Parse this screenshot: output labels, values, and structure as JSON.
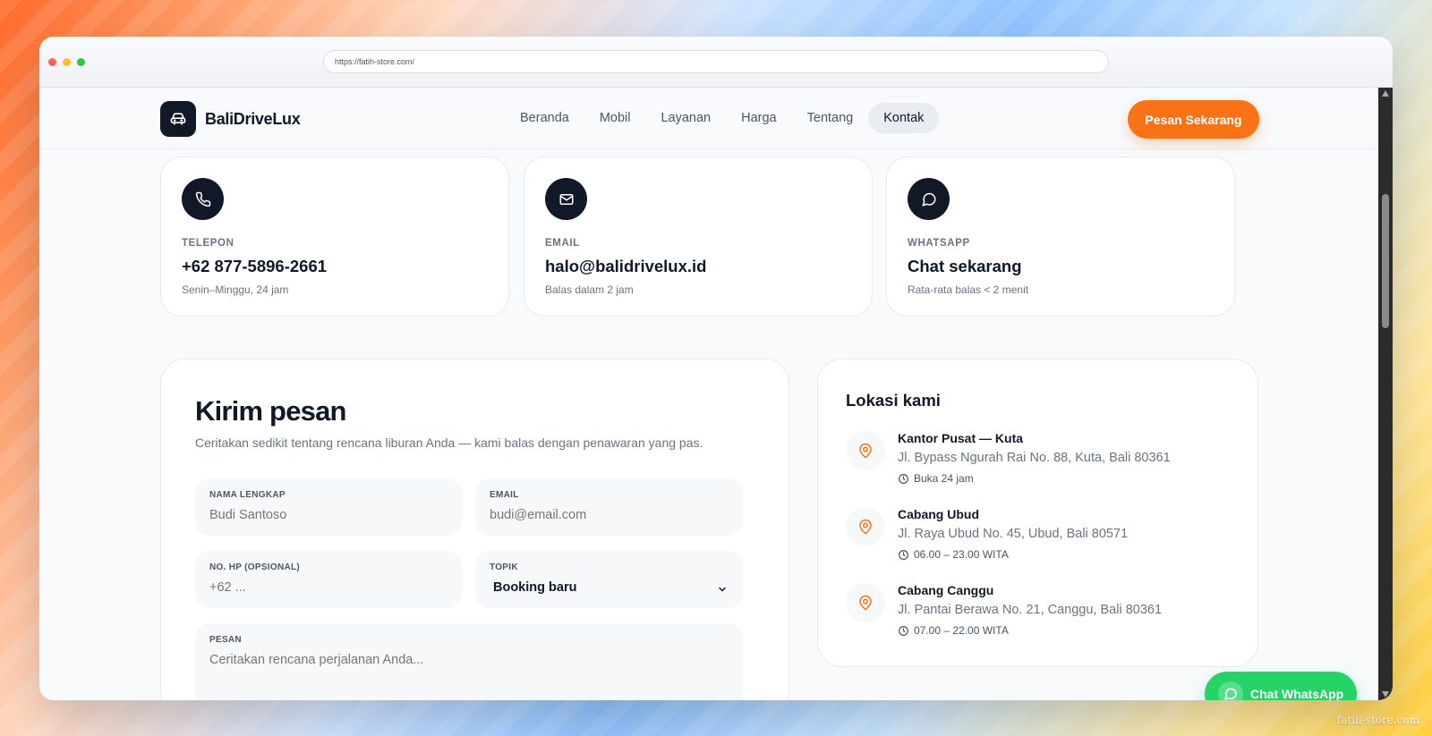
{
  "browser": {
    "url": "https://fatih-store.com/"
  },
  "watermark": "fatih-store.com",
  "header": {
    "brand": "BaliDriveLux",
    "nav": [
      {
        "label": "Beranda"
      },
      {
        "label": "Mobil"
      },
      {
        "label": "Layanan"
      },
      {
        "label": "Harga"
      },
      {
        "label": "Tentang"
      },
      {
        "label": "Kontak",
        "active": true
      }
    ],
    "cta_label": "Pesan Sekarang"
  },
  "contact_cards": [
    {
      "icon": "phone-icon",
      "label": "TELEPON",
      "value": "+62 877-5896-2661",
      "sub": "Senin–Minggu, 24 jam"
    },
    {
      "icon": "mail-icon",
      "label": "EMAIL",
      "value": "halo@balidrivelux.id",
      "sub": "Balas dalam 2 jam"
    },
    {
      "icon": "chat-bubble-icon",
      "label": "WHATSAPP",
      "value": "Chat sekarang",
      "sub": "Rata-rata balas < 2 menit"
    }
  ],
  "form": {
    "title": "Kirim pesan",
    "description": "Ceritakan sedikit tentang rencana liburan Anda — kami balas dengan penawaran yang pas.",
    "fields": {
      "name": {
        "label": "NAMA LENGKAP",
        "placeholder": "Budi Santoso"
      },
      "email": {
        "label": "EMAIL",
        "placeholder": "budi@email.com"
      },
      "phone": {
        "label": "NO. HP (OPSIONAL)",
        "placeholder": "+62 ..."
      },
      "topic": {
        "label": "TOPIK",
        "value": "Booking baru"
      },
      "message": {
        "label": "PESAN",
        "placeholder": "Ceritakan rencana perjalanan Anda..."
      }
    }
  },
  "locations": {
    "title": "Lokasi kami",
    "items": [
      {
        "name": "Kantor Pusat — Kuta",
        "address": "Jl. Bypass Ngurah Rai No. 88, Kuta, Bali 80361",
        "hours": "Buka 24 jam"
      },
      {
        "name": "Cabang Ubud",
        "address": "Jl. Raya Ubud No. 45, Ubud, Bali 80571",
        "hours": "06.00 – 23.00 WITA"
      },
      {
        "name": "Cabang Canggu",
        "address": "Jl. Pantai Berawa No. 21, Canggu, Bali 80361",
        "hours": "07.00 – 22.00 WITA"
      }
    ]
  },
  "whatsapp_button": {
    "label": "Chat WhatsApp"
  },
  "colors": {
    "accent": "#f97316",
    "dark": "#111827",
    "whatsapp": "#25d366"
  }
}
